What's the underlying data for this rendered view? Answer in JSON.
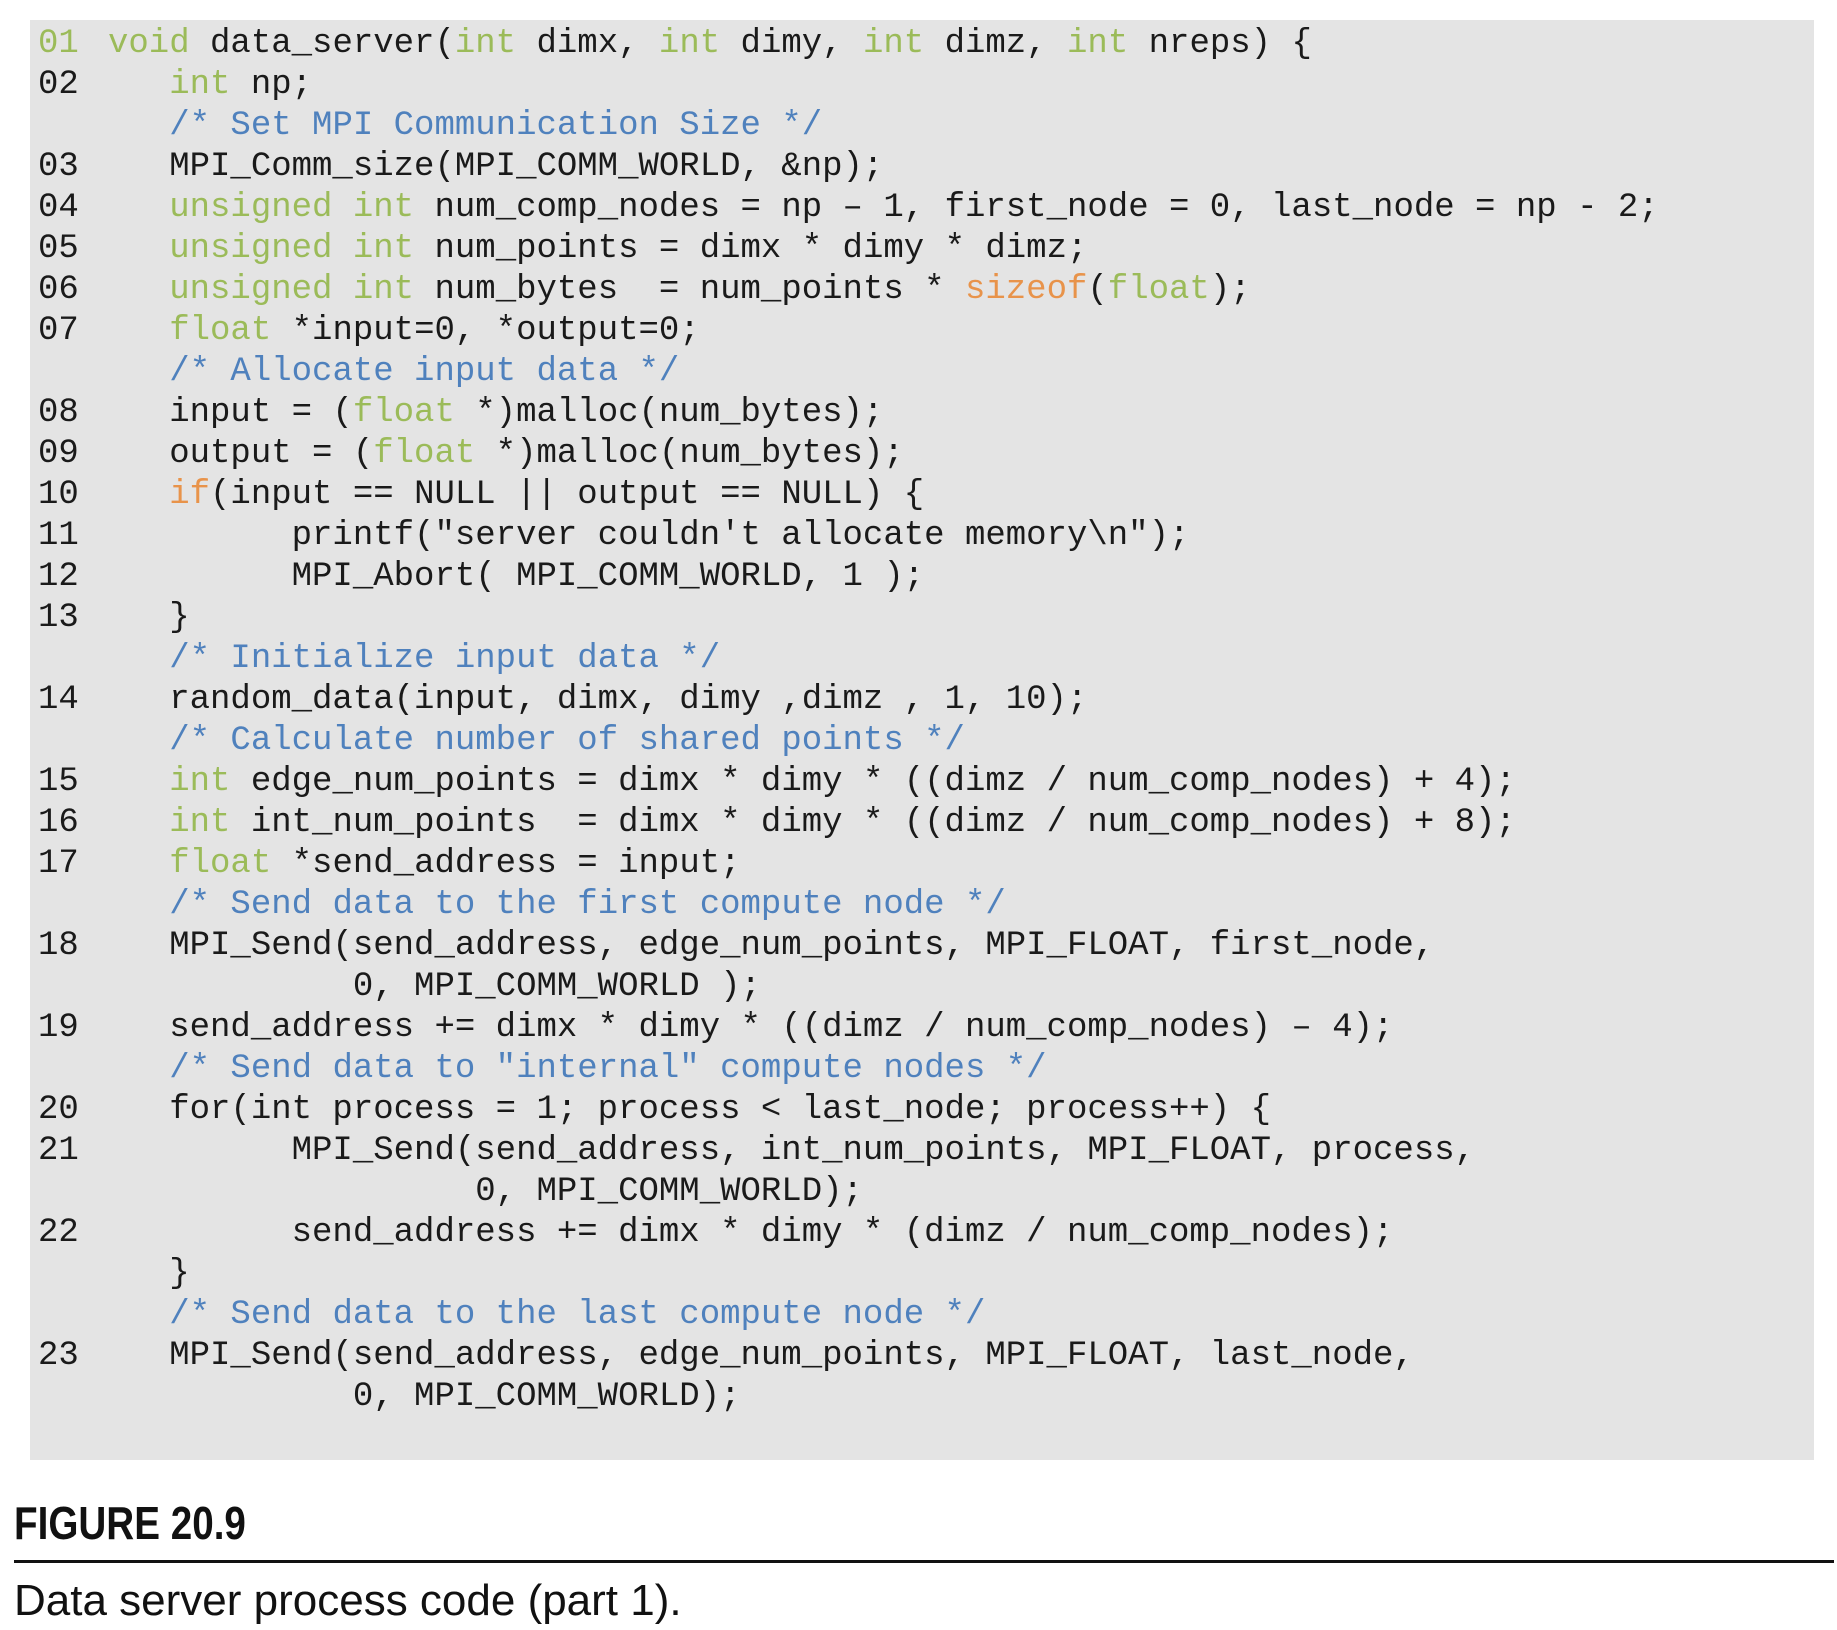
{
  "figure": {
    "label": "FIGURE 20.9",
    "caption": "Data server process code (part 1)."
  },
  "colors": {
    "background": "#e4e4e4",
    "keyword": "#9bbb59",
    "keyword_alt": "#e8934a",
    "comment": "#4f81bd",
    "text": "#1a1a1a"
  },
  "code_lines": [
    {
      "num": "01",
      "code": "void data_server(int dimx, int dimy, int dimz, int nreps) {"
    },
    {
      "num": "02",
      "code": "   int np;"
    },
    {
      "num": "",
      "code": "   /* Set MPI Communication Size */"
    },
    {
      "num": "03",
      "code": "   MPI_Comm_size(MPI_COMM_WORLD, &np);"
    },
    {
      "num": "04",
      "code": "   unsigned int num_comp_nodes = np – 1, first_node = 0, last_node = np - 2;"
    },
    {
      "num": "05",
      "code": "   unsigned int num_points = dimx * dimy * dimz;"
    },
    {
      "num": "06",
      "code": "   unsigned int num_bytes  = num_points * sizeof(float);"
    },
    {
      "num": "07",
      "code": "   float *input=0, *output=0;"
    },
    {
      "num": "",
      "code": "   /* Allocate input data */"
    },
    {
      "num": "08",
      "code": "   input = (float *)malloc(num_bytes);"
    },
    {
      "num": "09",
      "code": "   output = (float *)malloc(num_bytes);"
    },
    {
      "num": "10",
      "code": "   if(input == NULL || output == NULL) {"
    },
    {
      "num": "11",
      "code": "         printf(\"server couldn't allocate memory\\n\");"
    },
    {
      "num": "12",
      "code": "         MPI_Abort( MPI_COMM_WORLD, 1 );"
    },
    {
      "num": "13",
      "code": "   }"
    },
    {
      "num": "",
      "code": "   /* Initialize input data */"
    },
    {
      "num": "14",
      "code": "   random_data(input, dimx, dimy ,dimz , 1, 10);"
    },
    {
      "num": "",
      "code": "   /* Calculate number of shared points */"
    },
    {
      "num": "15",
      "code": "   int edge_num_points = dimx * dimy * ((dimz / num_comp_nodes) + 4);"
    },
    {
      "num": "16",
      "code": "   int int_num_points  = dimx * dimy * ((dimz / num_comp_nodes) + 8);"
    },
    {
      "num": "17",
      "code": "   float *send_address = input;"
    },
    {
      "num": "",
      "code": "   /* Send data to the first compute node */"
    },
    {
      "num": "18",
      "code": "   MPI_Send(send_address, edge_num_points, MPI_FLOAT, first_node,"
    },
    {
      "num": "",
      "code": "            0, MPI_COMM_WORLD );"
    },
    {
      "num": "19",
      "code": "   send_address += dimx * dimy * ((dimz / num_comp_nodes) – 4);"
    },
    {
      "num": "",
      "code": "   /* Send data to \"internal\" compute nodes */"
    },
    {
      "num": "20",
      "code": "   for(int process = 1; process < last_node; process++) {"
    },
    {
      "num": "21",
      "code": "         MPI_Send(send_address, int_num_points, MPI_FLOAT, process,"
    },
    {
      "num": "",
      "code": "                  0, MPI_COMM_WORLD);"
    },
    {
      "num": "22",
      "code": "         send_address += dimx * dimy * (dimz / num_comp_nodes);"
    },
    {
      "num": "",
      "code": "   }"
    },
    {
      "num": "",
      "code": "   /* Send data to the last compute node */"
    },
    {
      "num": "23",
      "code": "   MPI_Send(send_address, edge_num_points, MPI_FLOAT, last_node,"
    },
    {
      "num": "",
      "code": "            0, MPI_COMM_WORLD);"
    }
  ]
}
